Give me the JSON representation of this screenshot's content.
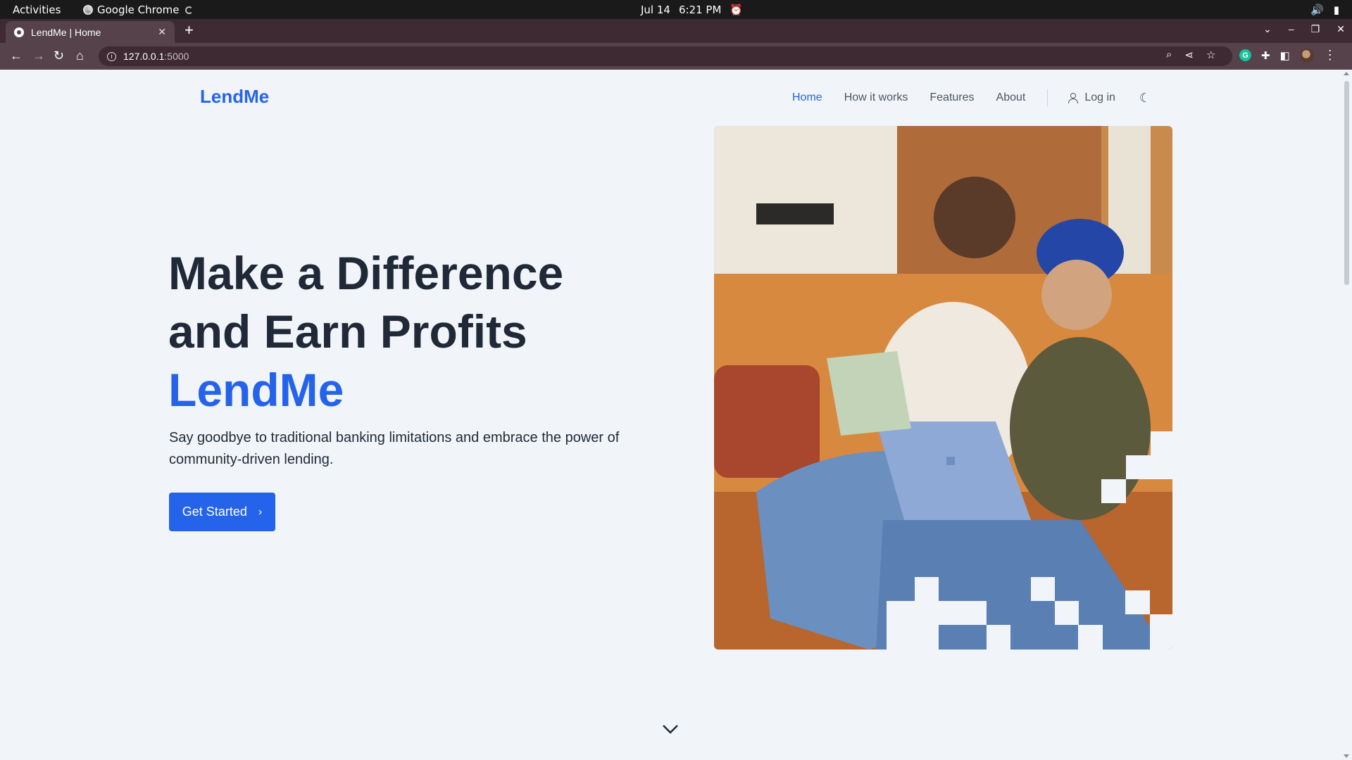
{
  "os": {
    "activities": "Activities",
    "app_name": "Google Chrome",
    "date": "Jul 14",
    "time": "6:21 PM"
  },
  "browser": {
    "tab_title": "LendMe | Home",
    "url_host": "127.0.0.1",
    "url_port": ":5000"
  },
  "site": {
    "brand": "LendMe",
    "nav": [
      "Home",
      "How it works",
      "Features",
      "About"
    ],
    "active_nav": "Home",
    "login_label": "Log in"
  },
  "hero": {
    "title_line1": "Make a Difference",
    "title_line2": "and Earn Profits",
    "title_accent": "LendMe",
    "subtitle": "Say goodbye to traditional banking limitations and embrace the power of community-driven lending.",
    "cta_label": "Get Started"
  },
  "colors": {
    "accent": "#2563eb",
    "heading": "#1f2937",
    "background": "#f1f5f9"
  },
  "icons": [
    "user-icon",
    "moon-icon",
    "chevron-right-icon",
    "chevron-down-icon"
  ]
}
